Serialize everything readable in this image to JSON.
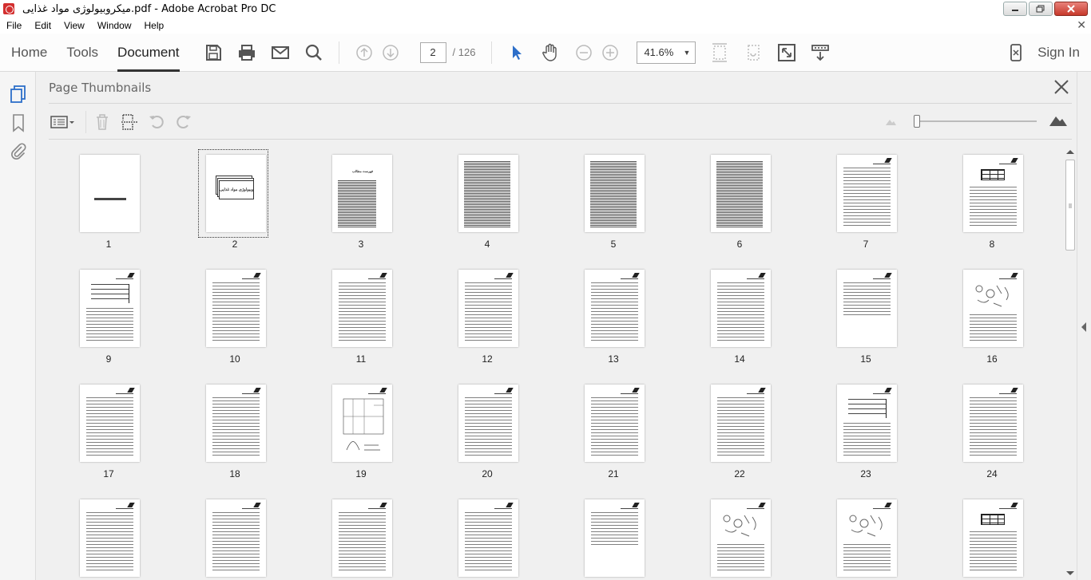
{
  "window": {
    "title": "میکروبیولوژی مواد غذایی.pdf - Adobe Acrobat Pro DC"
  },
  "menu": [
    "File",
    "Edit",
    "View",
    "Window",
    "Help"
  ],
  "toolbar": {
    "tabs": [
      "Home",
      "Tools",
      "Document"
    ],
    "active_tab": "Document",
    "page_current": "2",
    "page_total": "/ 126",
    "zoom": "41.6%",
    "sign_in": "Sign In"
  },
  "panel": {
    "title": "Page Thumbnails",
    "selected_page": 2
  },
  "thumbnails": [
    {
      "label": "1",
      "kind": "blank-title"
    },
    {
      "label": "2",
      "kind": "cover",
      "cover_title": "میکروبیولوژی مواد غذایی"
    },
    {
      "label": "3",
      "kind": "toc",
      "heading": "فهرست مطالب"
    },
    {
      "label": "4",
      "kind": "dense"
    },
    {
      "label": "5",
      "kind": "dense"
    },
    {
      "label": "6",
      "kind": "dense"
    },
    {
      "label": "7",
      "kind": "text"
    },
    {
      "label": "8",
      "kind": "table"
    },
    {
      "label": "9",
      "kind": "diagram"
    },
    {
      "label": "10",
      "kind": "text"
    },
    {
      "label": "11",
      "kind": "text"
    },
    {
      "label": "12",
      "kind": "text"
    },
    {
      "label": "13",
      "kind": "text"
    },
    {
      "label": "14",
      "kind": "text"
    },
    {
      "label": "15",
      "kind": "text-short"
    },
    {
      "label": "16",
      "kind": "figure"
    },
    {
      "label": "17",
      "kind": "text"
    },
    {
      "label": "18",
      "kind": "text"
    },
    {
      "label": "19",
      "kind": "chart"
    },
    {
      "label": "20",
      "kind": "text"
    },
    {
      "label": "21",
      "kind": "text"
    },
    {
      "label": "22",
      "kind": "text"
    },
    {
      "label": "23",
      "kind": "diagram"
    },
    {
      "label": "24",
      "kind": "text"
    },
    {
      "label": "",
      "kind": "text"
    },
    {
      "label": "",
      "kind": "text"
    },
    {
      "label": "",
      "kind": "text"
    },
    {
      "label": "",
      "kind": "text"
    },
    {
      "label": "",
      "kind": "text-short"
    },
    {
      "label": "",
      "kind": "figure"
    },
    {
      "label": "",
      "kind": "figure"
    },
    {
      "label": "",
      "kind": "table"
    }
  ]
}
